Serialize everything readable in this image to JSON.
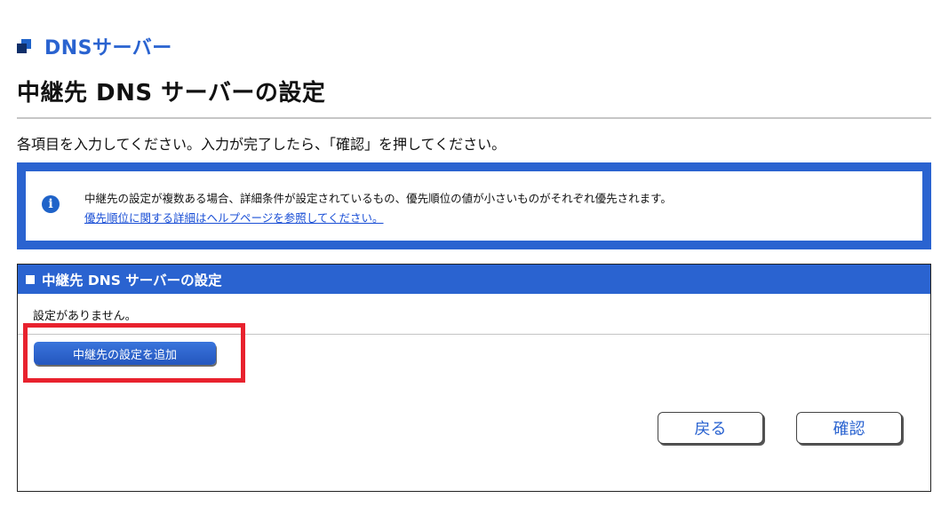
{
  "section": {
    "icon": "dns-section-icon",
    "title": "DNSサーバー"
  },
  "page": {
    "title": "中継先 DNS サーバーの設定",
    "instruction": "各項目を入力してください。入力が完了したら、「確認」を押してください。"
  },
  "info": {
    "icon": "info-icon",
    "message": "中継先の設定が複数ある場合、詳細条件が設定されているもの、優先順位の値が小さいものがそれぞれ優先されます。",
    "link_text": "優先順位に関する詳細はヘルプページを参照してください。"
  },
  "panel": {
    "title": "中継先 DNS サーバーの設定",
    "empty_message": "設定がありません。",
    "add_button_label": "中継先の設定を追加"
  },
  "actions": {
    "back_label": "戻る",
    "confirm_label": "確認"
  },
  "colors": {
    "accent": "#2a63d0",
    "highlight": "#e8222e",
    "link": "#1a4fd6"
  }
}
